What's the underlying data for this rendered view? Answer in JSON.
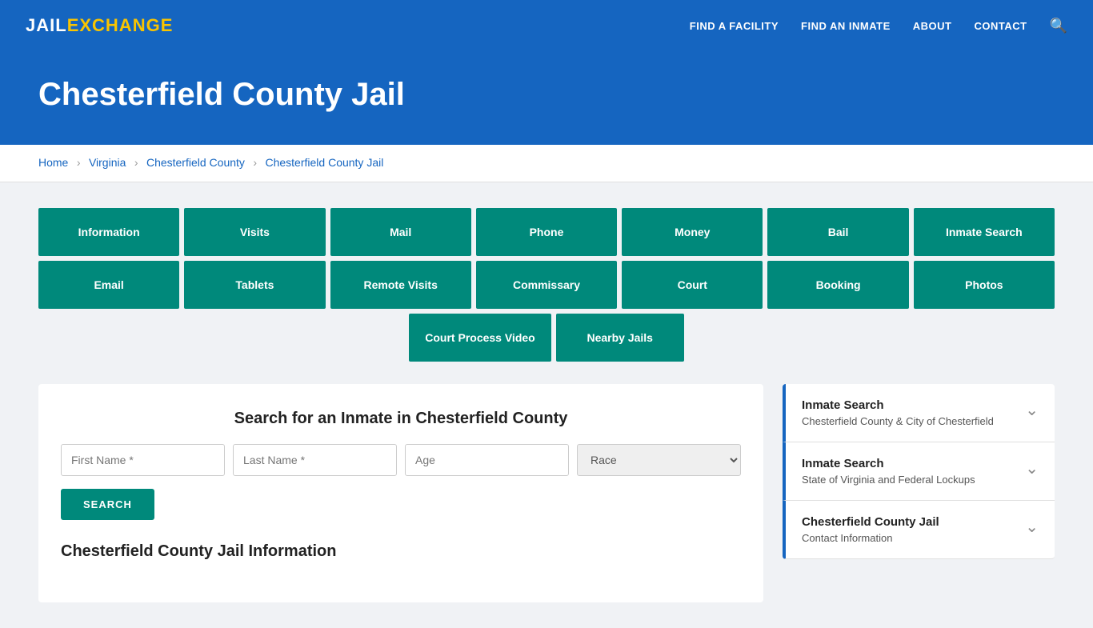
{
  "brand": {
    "part1": "JAIL",
    "part2": "EXCHANGE"
  },
  "nav": {
    "links": [
      {
        "label": "FIND A FACILITY",
        "href": "#"
      },
      {
        "label": "FIND AN INMATE",
        "href": "#"
      },
      {
        "label": "ABOUT",
        "href": "#"
      },
      {
        "label": "CONTACT",
        "href": "#"
      }
    ]
  },
  "hero": {
    "title": "Chesterfield County Jail"
  },
  "breadcrumb": {
    "items": [
      {
        "label": "Home",
        "href": "#"
      },
      {
        "label": "Virginia",
        "href": "#"
      },
      {
        "label": "Chesterfield County",
        "href": "#"
      },
      {
        "label": "Chesterfield County Jail",
        "href": "#"
      }
    ]
  },
  "buttons_row1": [
    "Information",
    "Visits",
    "Mail",
    "Phone",
    "Money",
    "Bail",
    "Inmate Search"
  ],
  "buttons_row2": [
    "Email",
    "Tablets",
    "Remote Visits",
    "Commissary",
    "Court",
    "Booking",
    "Photos"
  ],
  "buttons_row3": [
    "Court Process Video",
    "Nearby Jails"
  ],
  "search": {
    "title": "Search for an Inmate in Chesterfield County",
    "first_name_placeholder": "First Name *",
    "last_name_placeholder": "Last Name *",
    "age_placeholder": "Age",
    "race_placeholder": "Race",
    "button_label": "SEARCH"
  },
  "jail_info_heading": "Chesterfield County Jail Information",
  "sidebar": {
    "items": [
      {
        "title": "Inmate Search",
        "subtitle": "Chesterfield County & City of Chesterfield"
      },
      {
        "title": "Inmate Search",
        "subtitle": "State of Virginia and Federal Lockups"
      },
      {
        "title": "Chesterfield County Jail",
        "subtitle": "Contact Information"
      }
    ]
  }
}
